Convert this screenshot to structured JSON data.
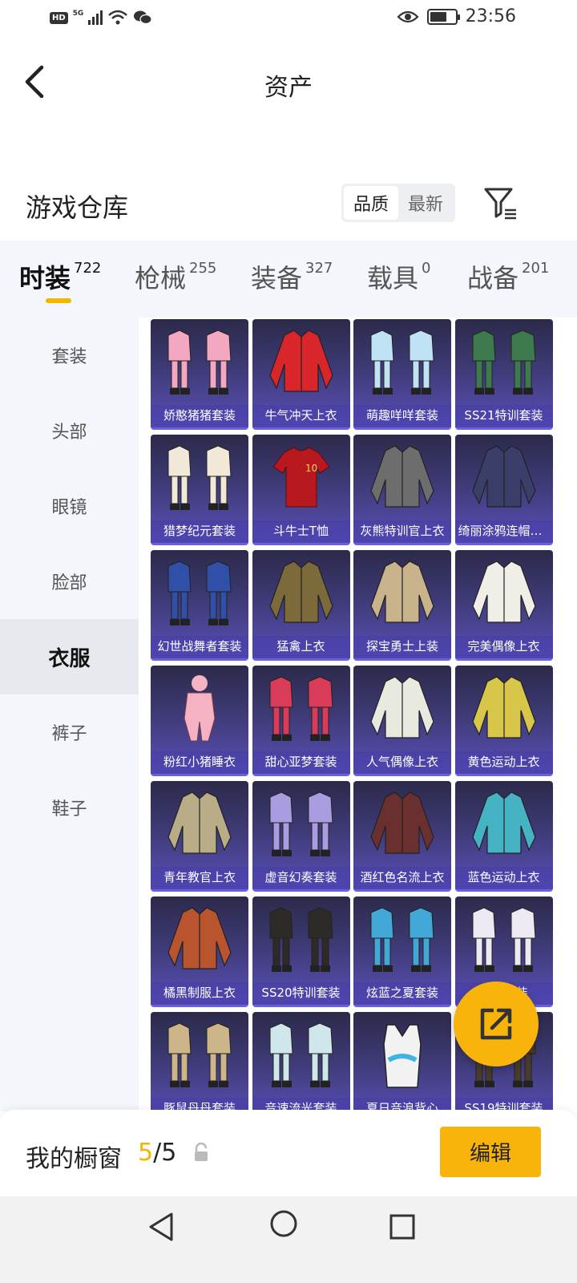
{
  "status_bar": {
    "network_hd": "HD",
    "network_type": "5G",
    "time": "23:56",
    "icons": [
      "signal-icon",
      "wifi-icon",
      "wechat-icon",
      "eye-icon",
      "battery-icon"
    ]
  },
  "header": {
    "title": "资产",
    "back_icon": "back-arrow-icon"
  },
  "warehouse": {
    "title": "游戏仓库",
    "sort_options": [
      {
        "label": "品质",
        "active": true
      },
      {
        "label": "最新",
        "active": false
      }
    ],
    "filter_icon": "filter-icon"
  },
  "categories": [
    {
      "label": "时装",
      "count": "722",
      "active": true
    },
    {
      "label": "枪械",
      "count": "255",
      "active": false
    },
    {
      "label": "装备",
      "count": "327",
      "active": false
    },
    {
      "label": "载具",
      "count": "0",
      "active": false
    },
    {
      "label": "战备",
      "count": "201",
      "active": false
    }
  ],
  "subcategories": [
    {
      "label": "套装",
      "active": false
    },
    {
      "label": "头部",
      "active": false
    },
    {
      "label": "眼镜",
      "active": false
    },
    {
      "label": "脸部",
      "active": false
    },
    {
      "label": "衣服",
      "active": true
    },
    {
      "label": "裤子",
      "active": false
    },
    {
      "label": "鞋子",
      "active": false
    }
  ],
  "items": [
    {
      "name": "娇憨猪猪套装",
      "kind": "suit",
      "color": "#f3a7c0"
    },
    {
      "name": "牛气冲天上衣",
      "kind": "jacket",
      "color": "#d8262b"
    },
    {
      "name": "萌趣咩咩套装",
      "kind": "suit",
      "color": "#bfe3f5"
    },
    {
      "name": "SS21特训套装",
      "kind": "suit",
      "color": "#3d7a4e"
    },
    {
      "name": "猎梦纪元套装",
      "kind": "suit",
      "color": "#f2e8d8"
    },
    {
      "name": "斗牛士T恤",
      "kind": "tshirt",
      "color": "#b8191f"
    },
    {
      "name": "灰熊特训官上衣",
      "kind": "jacket",
      "color": "#6d6d6d"
    },
    {
      "name": "绮丽涂鸦连帽卫衣",
      "kind": "jacket",
      "color": "#3a3f6a"
    },
    {
      "name": "幻世战舞者套装",
      "kind": "suit",
      "color": "#2f4fa8"
    },
    {
      "name": "猛禽上衣",
      "kind": "jacket",
      "color": "#7d6a3a"
    },
    {
      "name": "探宝勇士上装",
      "kind": "jacket",
      "color": "#c9b38a"
    },
    {
      "name": "完美偶像上衣",
      "kind": "jacket",
      "color": "#f0eee6"
    },
    {
      "name": "粉红小猪睡衣",
      "kind": "onesie",
      "color": "#f4b2c2"
    },
    {
      "name": "甜心亚梦套装",
      "kind": "suit",
      "color": "#d93c58"
    },
    {
      "name": "人气偶像上衣",
      "kind": "jacket",
      "color": "#e8eadf"
    },
    {
      "name": "黄色运动上衣",
      "kind": "jacket",
      "color": "#d8c64a"
    },
    {
      "name": "青年教官上衣",
      "kind": "jacket",
      "color": "#b9ad88"
    },
    {
      "name": "虚音幻奏套装",
      "kind": "suit",
      "color": "#a99ce0"
    },
    {
      "name": "酒红色名流上衣",
      "kind": "jacket",
      "color": "#6a2f2f"
    },
    {
      "name": "蓝色运动上衣",
      "kind": "jacket",
      "color": "#45b3c4"
    },
    {
      "name": "橘黑制服上衣",
      "kind": "jacket",
      "color": "#b9552e"
    },
    {
      "name": "SS20特训套装",
      "kind": "suit",
      "color": "#2e2a28"
    },
    {
      "name": "炫蓝之夏套装",
      "kind": "suit",
      "color": "#41a8d8"
    },
    {
      "name": "未知套装",
      "kind": "suit",
      "color": "#ece9f3"
    },
    {
      "name": "豚鼠丹丹套装",
      "kind": "suit",
      "color": "#cdb58a"
    },
    {
      "name": "音速流光套装",
      "kind": "suit",
      "color": "#cfe6ea"
    },
    {
      "name": "夏日音浪背心",
      "kind": "vest",
      "color": "#f2f2f2"
    },
    {
      "name": "SS19特训套装",
      "kind": "suit",
      "color": "#4a3c2a"
    }
  ],
  "share_icon": "share-icon",
  "showcase": {
    "label": "我的橱窗",
    "current": "5",
    "separator": "/",
    "total": "5",
    "lock_icon": "lock-icon",
    "edit_label": "编辑"
  },
  "system_nav": {
    "icons": [
      "nav-back-icon",
      "nav-home-icon",
      "nav-recent-icon"
    ]
  }
}
